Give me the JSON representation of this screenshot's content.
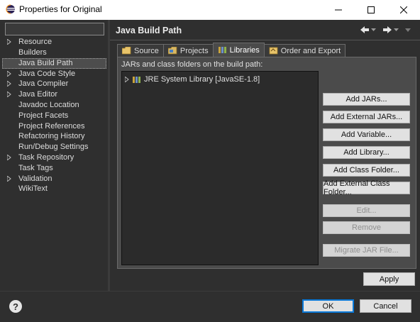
{
  "window": {
    "title": "Properties for Original",
    "minimize_icon": "minimize-icon",
    "maximize_icon": "maximize-icon",
    "close_icon": "close-icon"
  },
  "sidebar": {
    "filter_value": "",
    "items": [
      {
        "label": "Resource",
        "expandable": true
      },
      {
        "label": "Builders",
        "expandable": false
      },
      {
        "label": "Java Build Path",
        "expandable": false,
        "selected": true
      },
      {
        "label": "Java Code Style",
        "expandable": true
      },
      {
        "label": "Java Compiler",
        "expandable": true
      },
      {
        "label": "Java Editor",
        "expandable": true
      },
      {
        "label": "Javadoc Location",
        "expandable": false
      },
      {
        "label": "Project Facets",
        "expandable": false
      },
      {
        "label": "Project References",
        "expandable": false
      },
      {
        "label": "Refactoring History",
        "expandable": false
      },
      {
        "label": "Run/Debug Settings",
        "expandable": false
      },
      {
        "label": "Task Repository",
        "expandable": true
      },
      {
        "label": "Task Tags",
        "expandable": false
      },
      {
        "label": "Validation",
        "expandable": true
      },
      {
        "label": "WikiText",
        "expandable": false
      }
    ]
  },
  "main": {
    "page_title": "Java Build Path",
    "tabs": [
      {
        "label": "Source",
        "icon": "source-folder-icon"
      },
      {
        "label": "Projects",
        "icon": "projects-icon"
      },
      {
        "label": "Libraries",
        "icon": "libraries-icon",
        "active": true
      },
      {
        "label": "Order and Export",
        "icon": "order-export-icon"
      }
    ],
    "list_label": "JARs and class folders on the build path:",
    "list_items": [
      {
        "label": "JRE System Library [JavaSE-1.8]",
        "icon": "library-icon"
      }
    ],
    "buttons": {
      "add_jars": "Add JARs...",
      "add_external_jars": "Add External JARs...",
      "add_variable": "Add Variable...",
      "add_library": "Add Library...",
      "add_class_folder": "Add Class Folder...",
      "add_external_class_folder": "Add External Class Folder...",
      "edit": "Edit...",
      "remove": "Remove",
      "migrate_jar": "Migrate JAR File..."
    },
    "apply_label": "Apply"
  },
  "footer": {
    "help_label": "?",
    "ok_label": "OK",
    "cancel_label": "Cancel"
  },
  "colors": {
    "background": "#2f2f2f",
    "focus": "#0a78d7"
  }
}
